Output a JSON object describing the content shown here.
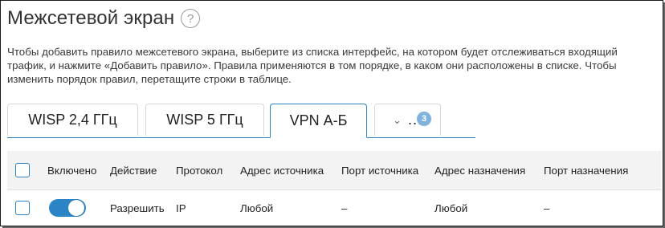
{
  "page": {
    "title": "Межсетевой экран",
    "help_icon": "question-circle-icon",
    "help_glyph": "?",
    "description": "Чтобы добавить правило межсетевого экрана, выберите из списка интерфейс, на котором будет отслеживаться входящий трафик, и нажмите «Добавить правило». Правила применяются в том порядке, в каком они расположены в списке. Чтобы изменить порядок правил, перетащите строки в таблице."
  },
  "tabs": [
    {
      "label": "WISP 2,4 ГГц",
      "active": false
    },
    {
      "label": "WISP 5 ГГц",
      "active": false
    },
    {
      "label": "VPN А-Б",
      "active": true
    }
  ],
  "more_tab": {
    "icon": "chevron-down-icon",
    "label": "...",
    "badge": "3"
  },
  "table": {
    "columns": [
      "Включено",
      "Действие",
      "Протокол",
      "Адрес источника",
      "Порт источника",
      "Адрес назначения",
      "Порт назначения"
    ],
    "rows": [
      {
        "enabled": true,
        "action": "Разрешить",
        "protocol": "IP",
        "src_addr": "Любой",
        "src_port": "–",
        "dst_addr": "Любой",
        "dst_port": "–"
      }
    ]
  },
  "colors": {
    "accent": "#2a84c6",
    "badge": "#7fb3dd",
    "header_bg": "#f3f3f3"
  }
}
